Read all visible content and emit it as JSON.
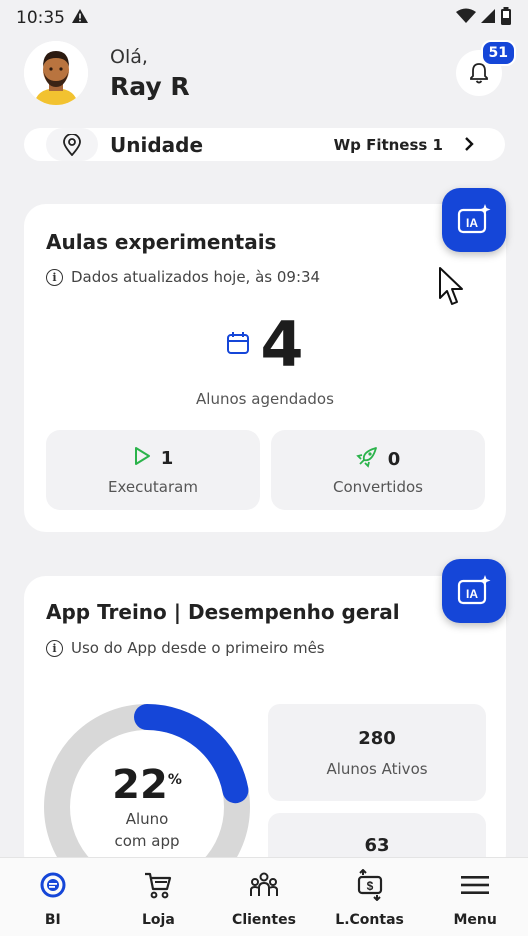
{
  "status_bar": {
    "time": "10:35"
  },
  "header": {
    "greeting": "Olá,",
    "user_name": "Ray R",
    "notification_count": "51"
  },
  "unit": {
    "label": "Unidade",
    "value": "Wp Fitness 1"
  },
  "aulas_card": {
    "title": "Aulas experimentais",
    "updated": "Dados atualizados hoje, às 09:34",
    "count": "4",
    "count_caption": "Alunos agendados",
    "executed_value": "1",
    "executed_label": "Executaram",
    "converted_value": "0",
    "converted_label": "Convertidos",
    "ia_label": "IA"
  },
  "app_card": {
    "title": "App Treino | Desempenho geral",
    "info": "Uso do App desde o primeiro mês",
    "percent": "22",
    "percent_symbol": "%",
    "percent_value": 22,
    "donut_label_1": "Aluno",
    "donut_label_2": "com app",
    "active_value": "280",
    "active_label": "Alunos Ativos",
    "second_value": "63",
    "ia_label": "IA"
  },
  "nav": {
    "items": [
      {
        "label": "BI",
        "icon": "bi-icon",
        "active": true
      },
      {
        "label": "Loja",
        "icon": "cart-icon"
      },
      {
        "label": "Clientes",
        "icon": "clients-icon"
      },
      {
        "label": "L.Contas",
        "icon": "accounts-icon"
      },
      {
        "label": "Menu",
        "icon": "menu-icon"
      }
    ]
  },
  "colors": {
    "accent": "#1546d8",
    "green": "#2bb34b",
    "donut_track": "#d8d8d8"
  }
}
